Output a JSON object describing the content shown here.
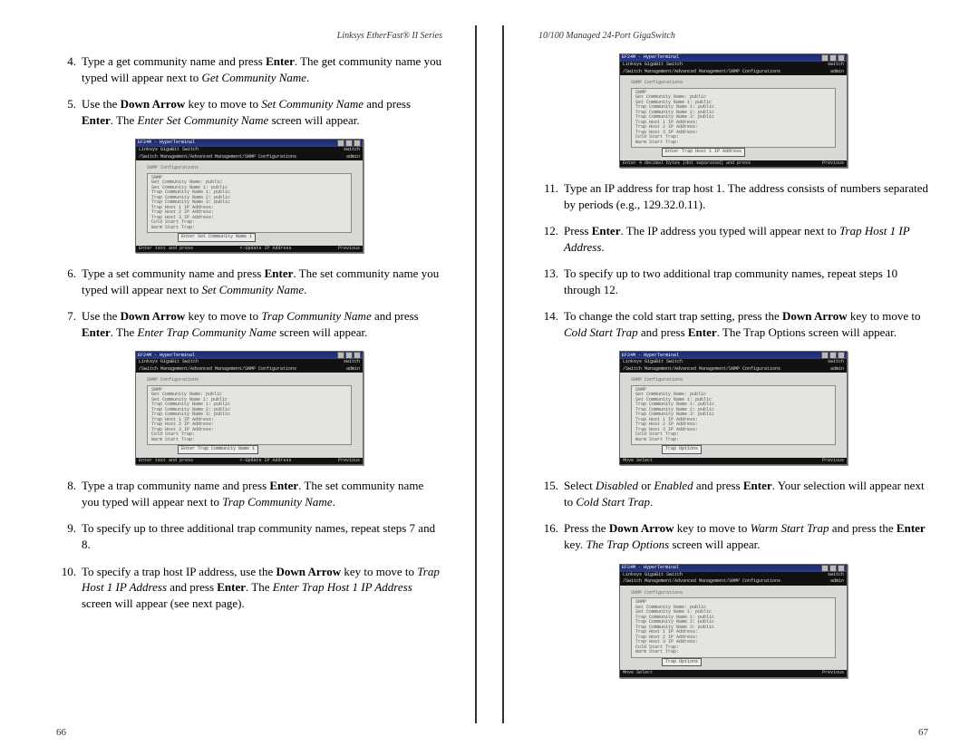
{
  "left": {
    "header": "Linksys EtherFast® II Series",
    "pageno": "66",
    "steps": [
      {
        "n": "4.",
        "parts": [
          {
            "t": "Type a get community name and press "
          },
          {
            "t": "Enter",
            "b": true
          },
          {
            "t": ". The get community name you typed will appear next to "
          },
          {
            "t": "Get Community Name",
            "i": true
          },
          {
            "t": "."
          }
        ]
      },
      {
        "n": "5.",
        "parts": [
          {
            "t": "Use the "
          },
          {
            "t": "Down Arrow",
            "b": true
          },
          {
            "t": " key to move to "
          },
          {
            "t": "Set Community Name",
            "i": true
          },
          {
            "t": " and press "
          },
          {
            "t": "Enter",
            "b": true
          },
          {
            "t": ". The "
          },
          {
            "t": "Enter Set Community Name",
            "i": true
          },
          {
            "t": " screen will appear."
          }
        ]
      },
      {
        "n": "6.",
        "parts": [
          {
            "t": "Type a set community name and press "
          },
          {
            "t": "Enter",
            "b": true
          },
          {
            "t": ". The set community name you typed will appear next to "
          },
          {
            "t": "Set Community Name",
            "i": true
          },
          {
            "t": "."
          }
        ]
      },
      {
        "n": "7.",
        "parts": [
          {
            "t": "Use the "
          },
          {
            "t": "Down Arrow",
            "b": true
          },
          {
            "t": " key to move to "
          },
          {
            "t": "Trap Community Name",
            "i": true
          },
          {
            "t": " and press "
          },
          {
            "t": "Enter",
            "b": true
          },
          {
            "t": ". The "
          },
          {
            "t": "Enter Trap Community Name",
            "i": true
          },
          {
            "t": " screen will appear."
          }
        ]
      },
      {
        "n": "8.",
        "parts": [
          {
            "t": "Type a trap community name and press "
          },
          {
            "t": "Enter",
            "b": true
          },
          {
            "t": ". The set community name you typed will appear next to "
          },
          {
            "t": "Trap Community Name",
            "i": true
          },
          {
            "t": "."
          }
        ]
      },
      {
        "n": "9.",
        "parts": [
          {
            "t": "To specify up to three additional trap community names, repeat steps 7 and 8."
          }
        ]
      },
      {
        "n": "10.",
        "parts": [
          {
            "t": "To specify a trap host IP address, use the "
          },
          {
            "t": "Down Arrow",
            "b": true
          },
          {
            "t": " key to move to "
          },
          {
            "t": "Trap Host 1 IP Address",
            "i": true
          },
          {
            "t": " and press "
          },
          {
            "t": "Enter",
            "b": true
          },
          {
            "t": ". The "
          },
          {
            "t": "Enter Trap Host 1 IP Address",
            "i": true
          },
          {
            "t": " screen will appear (see next page)."
          }
        ]
      }
    ]
  },
  "right": {
    "header": "10/100 Managed 24-Port GigaSwitch",
    "pageno": "67",
    "steps": [
      {
        "n": "11.",
        "parts": [
          {
            "t": "Type an IP address for trap host 1. The address consists of numbers separated by periods (e.g., 129.32.0.11)."
          }
        ]
      },
      {
        "n": "12.",
        "parts": [
          {
            "t": "Press "
          },
          {
            "t": "Enter",
            "b": true
          },
          {
            "t": ". The IP address you typed will appear next to "
          },
          {
            "t": "Trap Host 1 IP Address",
            "i": true
          },
          {
            "t": "."
          }
        ]
      },
      {
        "n": "13.",
        "parts": [
          {
            "t": "To specify up to two additional trap community names, repeat steps 10 through 12."
          }
        ]
      },
      {
        "n": "14.",
        "parts": [
          {
            "t": "To change the cold start trap setting, press the "
          },
          {
            "t": "Down Arrow",
            "b": true
          },
          {
            "t": " key to move to "
          },
          {
            "t": "Cold Start Trap",
            "i": true
          },
          {
            "t": " and press "
          },
          {
            "t": "Enter",
            "b": true
          },
          {
            "t": ". The Trap Options screen will appear."
          }
        ]
      },
      {
        "n": "15.",
        "parts": [
          {
            "t": "Select "
          },
          {
            "t": "Disabled",
            "i": true
          },
          {
            "t": " or "
          },
          {
            "t": "Enabled",
            "i": true
          },
          {
            "t": " and press "
          },
          {
            "t": "Enter",
            "b": true
          },
          {
            "t": ". Your selection will appear next to "
          },
          {
            "t": "Cold Start Trap",
            "i": true
          },
          {
            "t": "."
          }
        ]
      },
      {
        "n": "16.",
        "parts": [
          {
            "t": "Press the "
          },
          {
            "t": "Down Arrow",
            "b": true
          },
          {
            "t": " key to move to "
          },
          {
            "t": "Warm Start Trap",
            "i": true
          },
          {
            "t": " and press the "
          },
          {
            "t": "Enter",
            "b": true
          },
          {
            "t": " key. "
          },
          {
            "t": "The Trap Options",
            "i": true
          },
          {
            "t": " screen will appear."
          }
        ]
      }
    ]
  },
  "screenshot_common": {
    "titlebar": "EF24M - HyperTerminal",
    "black1_left": "Linksys GigaBit Switch",
    "black1_right": "switch",
    "black2_left": "/Switch Management/Advanced Management/SNMP Configurations",
    "black2_right": "admin",
    "label": "SNMP Configurations",
    "rows": "SNMP  <Enabled>\nGet Community Name: public\nSet Community Name 1: public\nTrap Community Name 1: public\nTrap Community Name 2: public\nTrap Community Name 3: public\nTrap Host 1 IP Address:\nTrap Host 2 IP Address:\nTrap Host 3 IP Address:\nCold Start Trap: <Enabled>\nWarm Start Trap: <Enabled>\n<Click Down>"
  },
  "screenshots": [
    {
      "popup": "Enter Set Community Name 1",
      "status_left": "Enter text and press <ENTER>",
      "status_mid": "<-Update IP Address",
      "status_right": "<ESC>Previous"
    },
    {
      "popup": "Enter Trap Community Name 1",
      "status_left": "Enter text and press <ENTER>",
      "status_mid": "<-Update IP Address",
      "status_right": "<ESC>Previous"
    },
    {
      "popup": "Enter Trap Host 1 IP Address",
      "status_left": "Enter 4 decimal bytes (dot separated) and press <ENTER>",
      "status_mid": "",
      "status_right": "<ESC>Previous"
    },
    {
      "popup": "Trap Options",
      "status_left": "<UpArrow><DownArrow>Move  <Enter>Select",
      "status_mid": "",
      "status_right": "<ESC>Previous"
    },
    {
      "popup": "Trap Options",
      "status_left": "<UpArrow><DownArrow>Move  <Enter>Select",
      "status_mid": "",
      "status_right": "<ESC>Previous"
    }
  ]
}
